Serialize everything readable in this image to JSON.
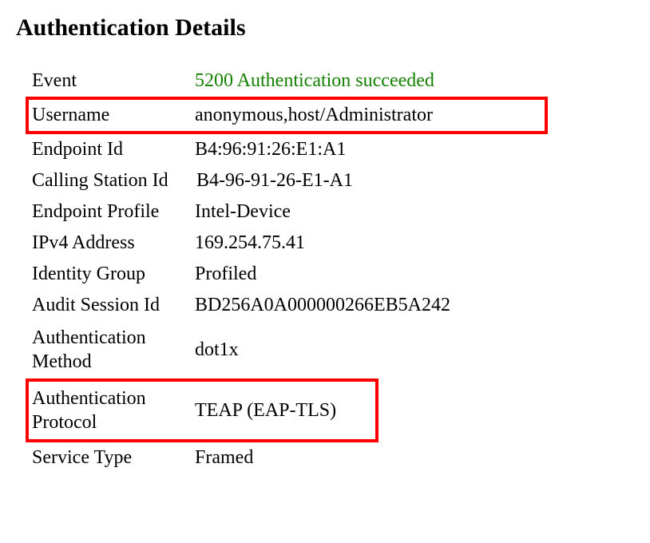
{
  "title": "Authentication Details",
  "rows": {
    "event": {
      "label": "Event",
      "value": "5200 Authentication succeeded"
    },
    "username": {
      "label": "Username",
      "value": "anonymous,host/Administrator"
    },
    "endpoint_id": {
      "label": "Endpoint Id",
      "value": "B4:96:91:26:E1:A1"
    },
    "calling_station_id": {
      "label": "Calling Station Id",
      "value": "B4-96-91-26-E1-A1"
    },
    "endpoint_profile": {
      "label": "Endpoint Profile",
      "value": "Intel-Device"
    },
    "ipv4_address": {
      "label": "IPv4 Address",
      "value": "169.254.75.41"
    },
    "identity_group": {
      "label": "Identity Group",
      "value": "Profiled"
    },
    "audit_session_id": {
      "label": "Audit Session Id",
      "value": "BD256A0A000000266EB5A242"
    },
    "auth_method": {
      "label": "Authentication Method",
      "value": "dot1x"
    },
    "auth_protocol": {
      "label": "Authentication Protocol",
      "value": "TEAP (EAP-TLS)"
    },
    "service_type": {
      "label": "Service Type",
      "value": "Framed"
    }
  },
  "highlights": [
    "username",
    "auth_protocol"
  ]
}
